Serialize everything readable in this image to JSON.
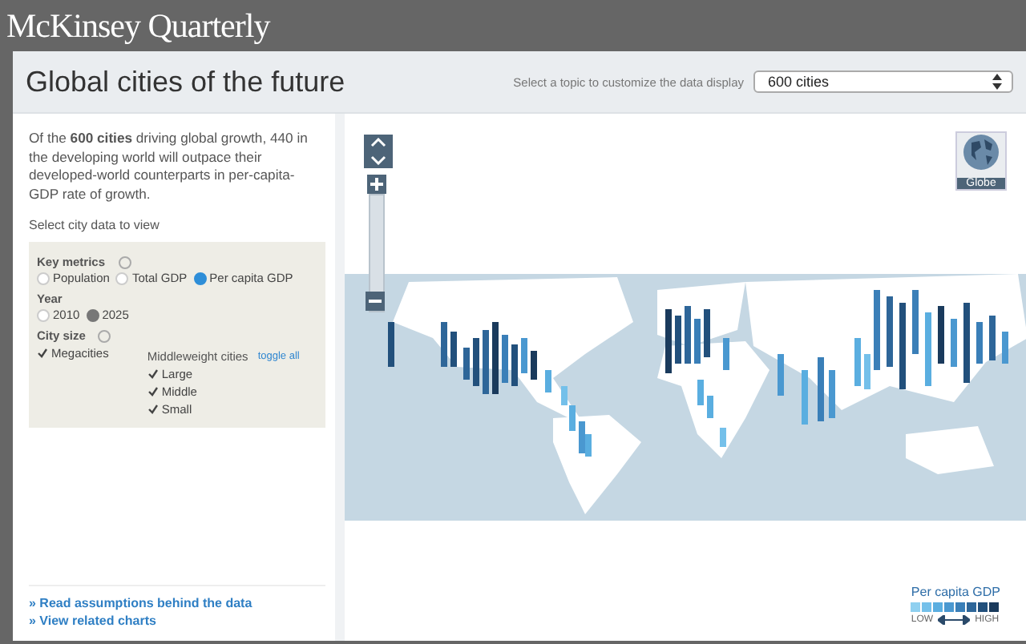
{
  "header": {
    "logo": "McKinsey Quarterly"
  },
  "title_bar": {
    "title": "Global cities of the future",
    "topic_label": "Select a topic to customize the data display",
    "topic_select": {
      "value": "600 cities"
    }
  },
  "sidebar": {
    "intro": "Of the **600 cities** driving global growth, 440 in the developing world will outpace their developed-world counterparts in per-capita-GDP rate of growth.",
    "select_label": "Select city data to view",
    "key_metrics": {
      "label": "Key metrics",
      "options": [
        {
          "label": "Population",
          "selected": false
        },
        {
          "label": "Total GDP",
          "selected": false
        },
        {
          "label": "Per capita GDP",
          "selected": true
        }
      ]
    },
    "year": {
      "label": "Year",
      "options": [
        {
          "label": "2010",
          "selected": false
        },
        {
          "label": "2025",
          "selected": true
        }
      ]
    },
    "city_size": {
      "label": "City size",
      "megacities": {
        "label": "Megacities",
        "checked": true
      },
      "middleweight_label": "Middleweight cities",
      "toggle_all": "toggle all",
      "middleweight": [
        {
          "label": "Large",
          "checked": true
        },
        {
          "label": "Middle",
          "checked": true
        },
        {
          "label": "Small",
          "checked": true
        }
      ]
    },
    "links": [
      "» Read assumptions behind the data",
      "» View related charts"
    ]
  },
  "map": {
    "zoom": {
      "level": 0
    },
    "globe_label": "Globe",
    "legend": {
      "title": "Per capita GDP",
      "swatches": [
        {
          "color": "#8fd0f0"
        },
        {
          "color": "#74c0ea"
        },
        {
          "color": "#5aaee0"
        },
        {
          "color": "#4a98d0"
        },
        {
          "color": "#3a7fb8"
        },
        {
          "color": "#2e6699"
        },
        {
          "color": "#22507c"
        },
        {
          "color": "#1a3a5c"
        }
      ],
      "low": "LOW",
      "high": "HIGH"
    }
  }
}
